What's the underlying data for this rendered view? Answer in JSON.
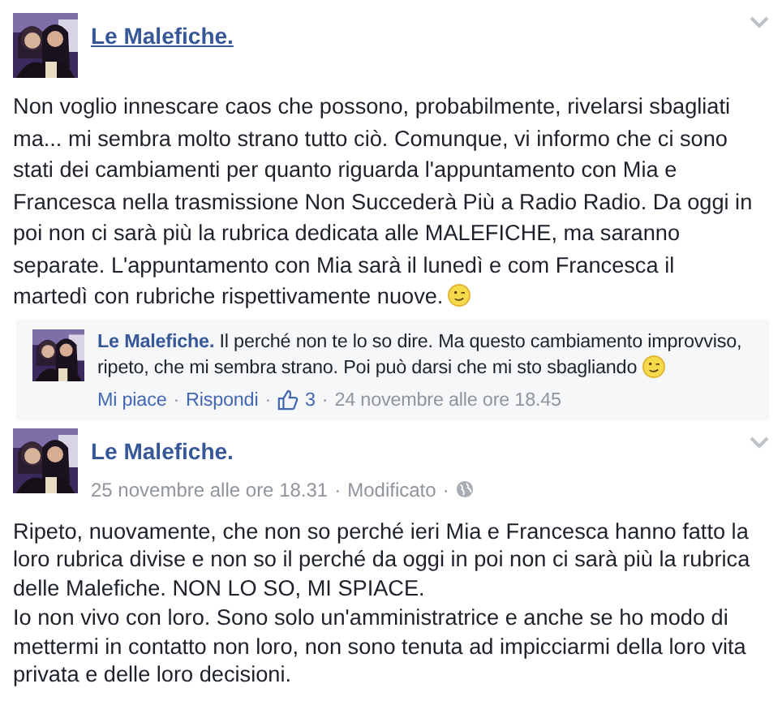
{
  "posts": [
    {
      "author": "Le Malefiche.",
      "paragraphs": [
        {
          "text": "Non voglio innescare caos che possono, probabilmente, rivelarsi sbagliati ma... mi sembra molto strano tutto ciò. Comunque, vi informo che ci sono stati dei cambiamenti per quanto riguarda l'appuntamento con Mia e Francesca nella trasmissione Non Succederà Più a Radio Radio. Da oggi in poi non ci sarà più la rubrica dedicata alle MALEFICHE, ma saranno separate. L'appuntamento con Mia sarà il lunedì e com Francesca il martedì con rubriche rispettivamente nuove.",
          "emoji": true
        }
      ],
      "comment": {
        "author": "Le Malefiche.",
        "text": "Il perché non te lo so dire. Ma questo cambiamento improvviso, ripeto, che mi sembra strano. Poi può darsi che mi sto sbagliando",
        "emoji": true,
        "actions": [
          {
            "kind": "link",
            "text": "Mi piace"
          },
          {
            "kind": "link",
            "text": "Rispondi"
          },
          {
            "kind": "likes",
            "text": "3"
          },
          {
            "kind": "time",
            "text": "24 novembre alle ore 18.45"
          }
        ]
      }
    },
    {
      "author": "Le Malefiche.",
      "meta": [
        {
          "kind": "time",
          "text": "25 novembre alle ore 18.31"
        },
        {
          "kind": "time",
          "text": "Modificato"
        },
        {
          "kind": "globe"
        }
      ],
      "paragraphs": [
        {
          "text": "Ripeto, nuovamente, che non so perché ieri Mia e Francesca hanno fatto la loro rubrica divise e non so il perché da oggi in poi non ci sarà più la rubrica delle Malefiche. NON LO SO, MI SPIACE."
        },
        {
          "text": "Io non vivo con loro. Sono solo un'amministratrice e anche se ho modo di mettermi in contatto non loro, non sono tenuta ad impicciarmi della loro vita privata e delle loro decisioni."
        }
      ]
    }
  ],
  "separator": "·"
}
